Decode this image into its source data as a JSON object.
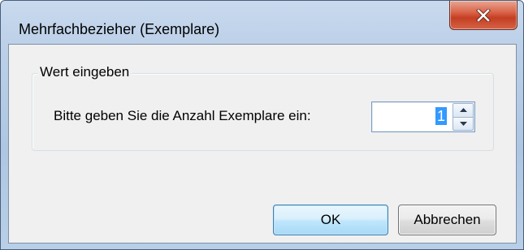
{
  "window": {
    "title": "Mehrfachbezieher (Exemplare)",
    "close_icon": "close-x-icon"
  },
  "group": {
    "legend": "Wert eingeben",
    "prompt": "Bitte geben Sie die Anzahl Exemplare ein:",
    "quantity_value": "1",
    "spin_up_icon": "triangle-up-icon",
    "spin_down_icon": "triangle-down-icon"
  },
  "buttons": {
    "ok_label": "OK",
    "cancel_label": "Abbrechen"
  },
  "colors": {
    "titlebar": "#bcd0e8",
    "close_button": "#c43e22",
    "client_bg": "#f0f0f0",
    "selection": "#3399ff",
    "default_button_border": "#3c7fb1"
  }
}
